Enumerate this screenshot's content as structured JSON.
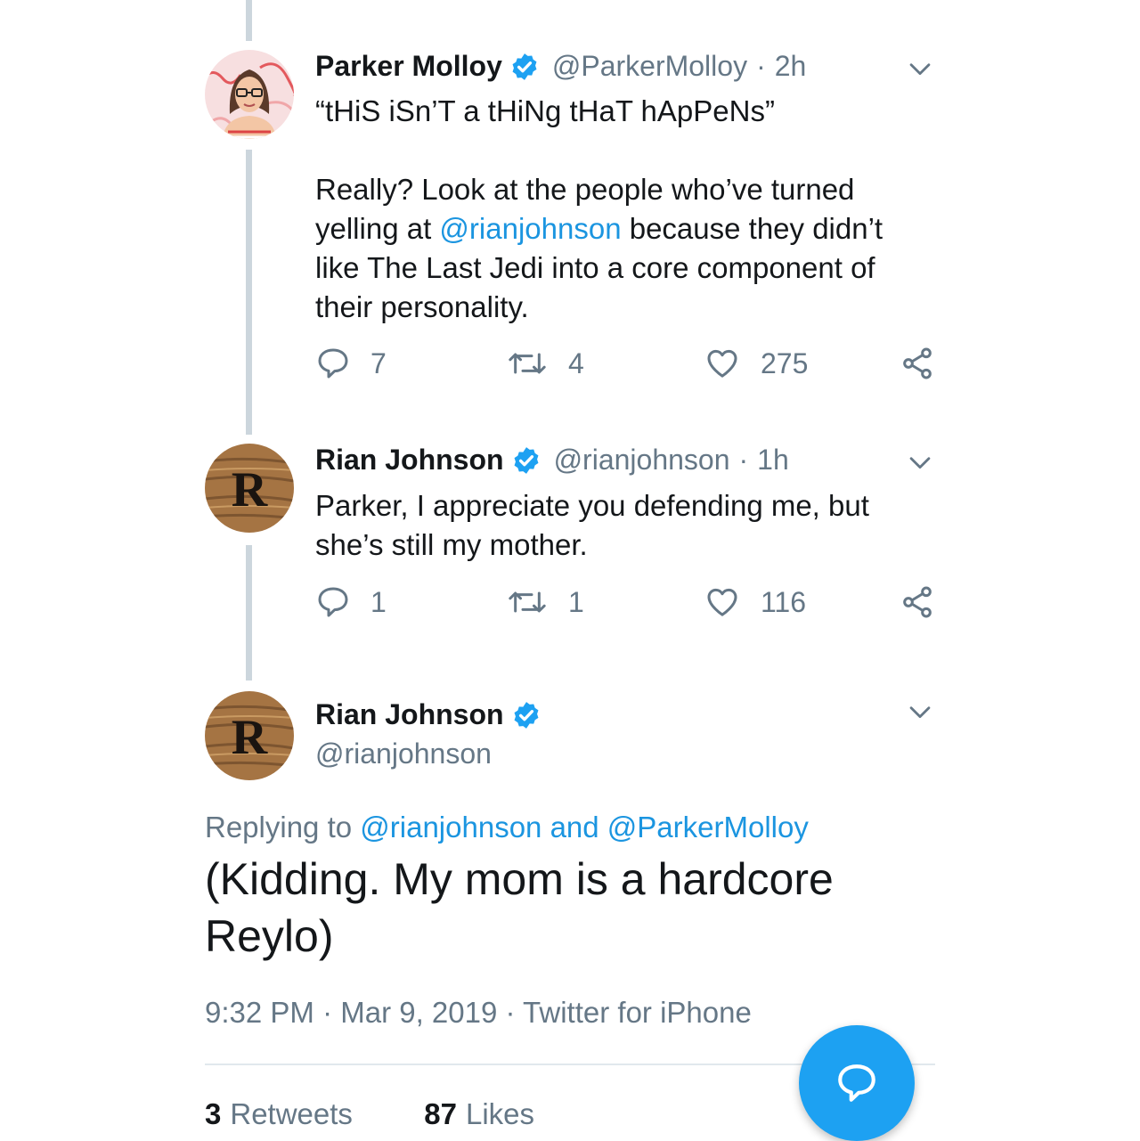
{
  "tweets": [
    {
      "name": "Parker Molloy",
      "handle": "@ParkerMolloy",
      "time": "2h",
      "text_lines": {
        "line1": "“tHiS iSn’T a tHiNg tHaT hApPeNs”",
        "before_link": "Really? Look at the people who’ve turned\nyelling at ",
        "link": "@rianjohnson",
        "after_link": " because they didn’t\nlike The Last Jedi into a core component of\ntheir personality."
      },
      "replies": "7",
      "retweets": "4",
      "likes": "275",
      "avatar_icon": "cartoon-woman-avatar"
    },
    {
      "name": "Rian Johnson",
      "handle": "@rianjohnson",
      "time": "1h",
      "text": "Parker, I appreciate you defending me, but\nshe’s still my mother.",
      "replies": "1",
      "retweets": "1",
      "likes": "116",
      "avatar_icon": "wooden-r-logo-avatar"
    }
  ],
  "focused": {
    "name": "Rian Johnson",
    "handle": "@rianjohnson",
    "replying_prefix": "Replying to",
    "replying_users": "@rianjohnson and @ParkerMolloy",
    "text": "(Kidding. My mom is a hardcore Reylo)",
    "timestamp": "9:32 PM · Mar 9, 2019 · Twitter for iPhone",
    "retweet_count": "3",
    "retweet_label": "Retweets",
    "like_count": "87",
    "like_label": "Likes"
  },
  "separator": "·",
  "colors": {
    "accent": "#1da1f2",
    "link": "#1b95e0",
    "muted": "#657786",
    "thread": "#ccd6dd"
  }
}
